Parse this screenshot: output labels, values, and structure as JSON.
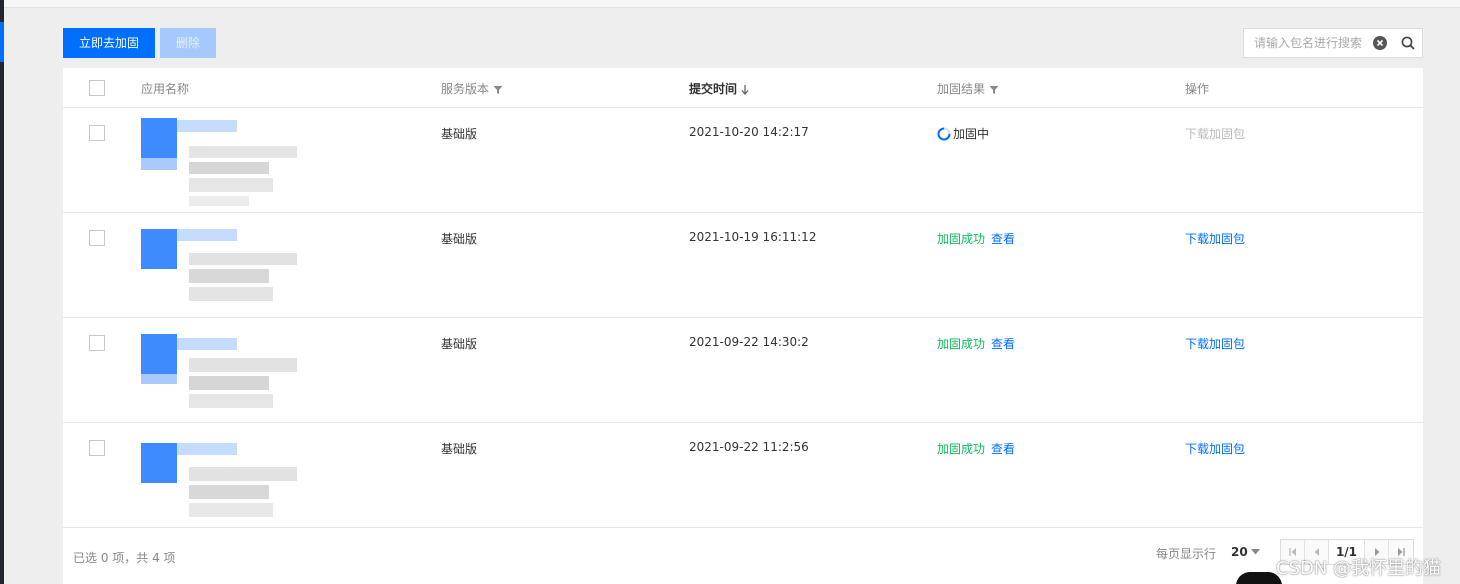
{
  "toolbar": {
    "primary_label": "立即去加固",
    "delete_label": "删除"
  },
  "search": {
    "placeholder": "请输入包名进行搜索",
    "value": ""
  },
  "table": {
    "headers": {
      "app_name": "应用名称",
      "version": "服务版本",
      "submit_time": "提交时间",
      "result": "加固结果",
      "action": "操作"
    },
    "rows": [
      {
        "version": "基础版",
        "time": "2021-10-20 14:2:17",
        "status": "加固中",
        "status_type": "processing",
        "view": "",
        "download": "下载加固包",
        "download_enabled": false
      },
      {
        "version": "基础版",
        "time": "2021-10-19 16:11:12",
        "status": "加固成功",
        "status_type": "success",
        "view": "查看",
        "download": "下载加固包",
        "download_enabled": true
      },
      {
        "version": "基础版",
        "time": "2021-09-22 14:30:2",
        "status": "加固成功",
        "status_type": "success",
        "view": "查看",
        "download": "下载加固包",
        "download_enabled": true
      },
      {
        "version": "基础版",
        "time": "2021-09-22 11:2:56",
        "status": "加固成功",
        "status_type": "success",
        "view": "查看",
        "download": "下载加固包",
        "download_enabled": true
      }
    ]
  },
  "footer": {
    "selection_text": "已选 0 项，共 4 项",
    "per_page_label": "每页显示行",
    "per_page_value": "20",
    "page_indicator": "1/1"
  },
  "watermark": "CSDN @我怀里的猫",
  "colors": {
    "primary": "#006eff",
    "success": "#0abf5b",
    "disabled": "#a3c9ff"
  }
}
